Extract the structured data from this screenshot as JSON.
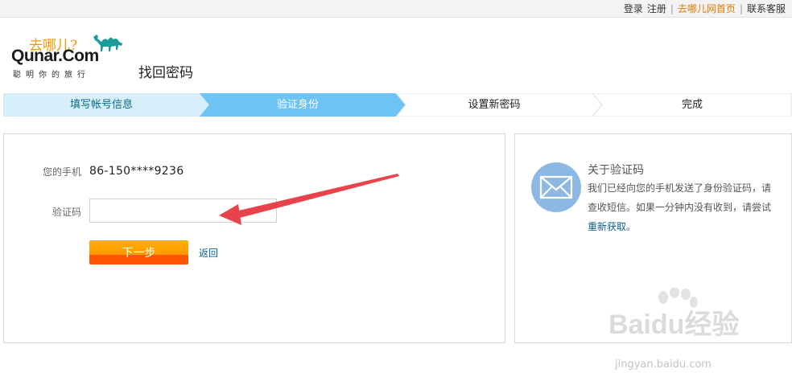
{
  "topbar": {
    "login": "登录",
    "register": "注册",
    "home": "去哪儿网首页",
    "contact": "联系客服",
    "sep": "|"
  },
  "logo": {
    "cn": "去哪儿?",
    "main": "Qunar.Com",
    "slogan": "聪明你的旅行"
  },
  "page_title": "找回密码",
  "steps": [
    {
      "label": "填写帐号信息",
      "state": "done"
    },
    {
      "label": "验证身份",
      "state": "active"
    },
    {
      "label": "设置新密码",
      "state": "pending"
    },
    {
      "label": "完成",
      "state": "pending"
    }
  ],
  "form": {
    "phone_label": "您的手机",
    "phone_value": "86-150****9236",
    "code_label": "验证码",
    "code_value": "",
    "next_button": "下一步",
    "back_link": "返回"
  },
  "info": {
    "title": "关于验证码",
    "text": "我们已经向您的手机发送了身份验证码，请查收短信。如果一分钟内没有收到，请尝试",
    "refresh": "重新获取",
    "period": "。"
  },
  "watermark": {
    "brand": "Baidu经验",
    "url": "jingyan.baidu.com"
  },
  "colors": {
    "step_done": "#d6effb",
    "step_active": "#6ec3f5",
    "button_orange": "#ff9900",
    "link": "#0a5f8c",
    "annotation_arrow": "#e8434a"
  }
}
